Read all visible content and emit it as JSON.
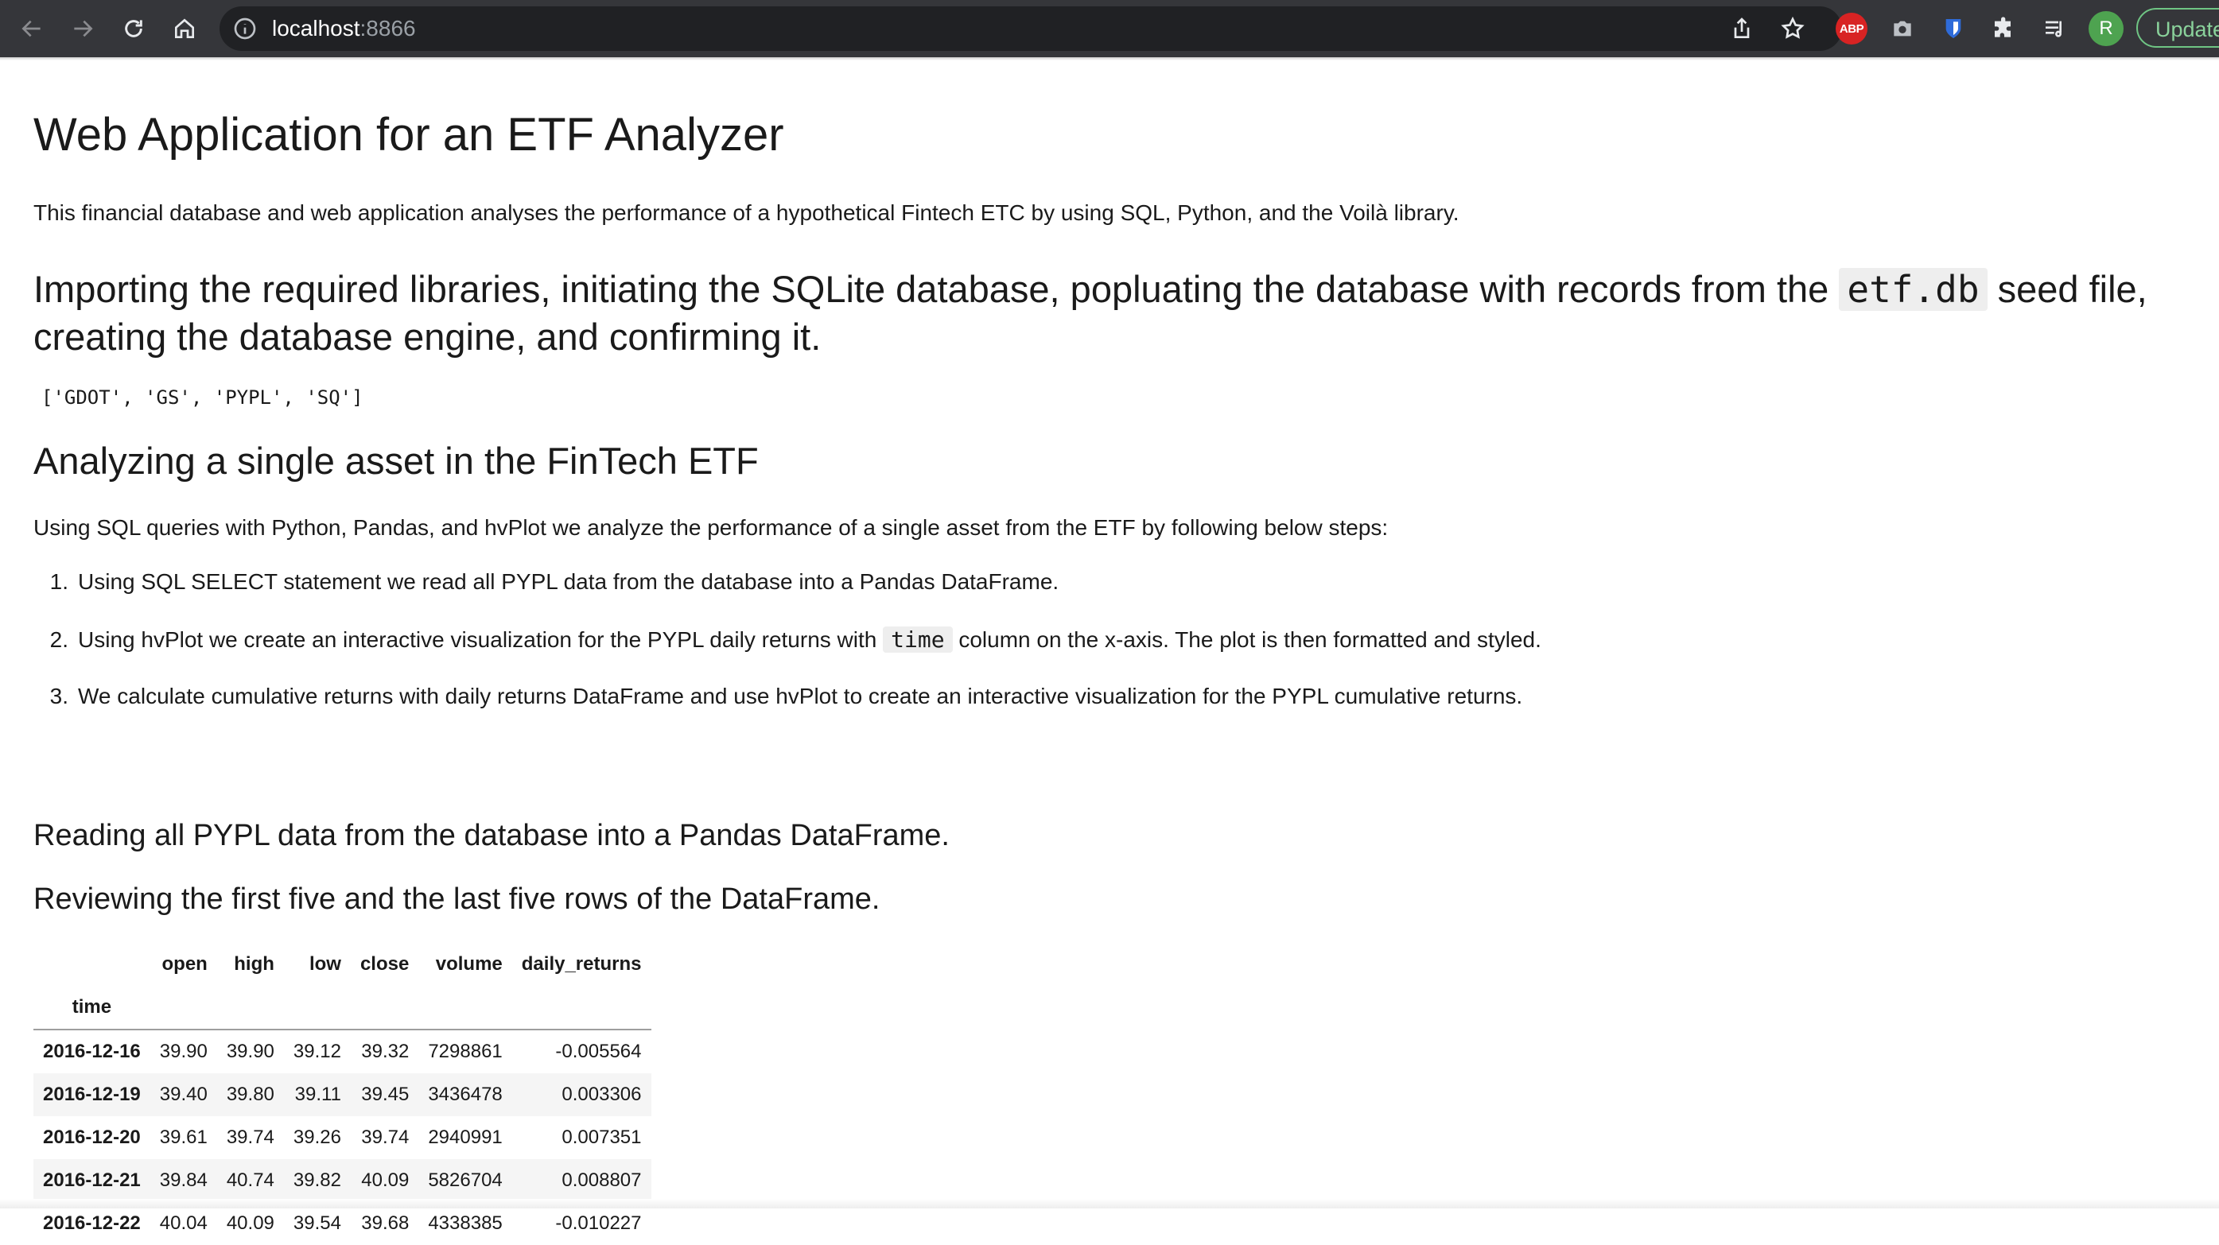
{
  "browser": {
    "url_host": "localhost",
    "url_port": ":8866",
    "profile_initial": "R",
    "update_label": "Update",
    "abp_label": "ABP",
    "avatar_color": "#4ea350",
    "icons": [
      "back-icon",
      "forward-icon",
      "reload-icon",
      "home-icon",
      "info-icon",
      "share-icon",
      "star-icon",
      "camera-icon",
      "bitwarden-icon",
      "puzzle-icon",
      "reading-list-icon"
    ]
  },
  "page": {
    "title": "Web Application for an ETF Analyzer",
    "intro": "This financial database and web application analyses the performance of a hypothetical Fintech ETC by using SQL, Python, and the Voilà library.",
    "import_heading": {
      "before": "Importing the required libraries, initiating the SQLite database, popluating the database with records from the ",
      "code": "etf.db",
      "after_line1": " seed file,",
      "line2": "creating the database engine, and confirming it."
    },
    "tables_output": "['GDOT', 'GS', 'PYPL', 'SQ']",
    "single_asset_heading": "Analyzing a single asset in the FinTech ETF",
    "steps_intro": "Using SQL queries with Python, Pandas, and hvPlot we analyze the performance of a single asset from the ETF by following below steps:",
    "steps": [
      {
        "num": "1.",
        "text": "Using SQL SELECT statement we read all PYPL data from the database into a Pandas DataFrame."
      },
      {
        "num": "2.",
        "before": "Using hvPlot we create an interactive visualization for the PYPL daily returns with ",
        "code": "time",
        "after": " column on the x-axis. The plot is then formatted and styled."
      },
      {
        "num": "3.",
        "text": "We calculate cumulative returns with daily returns DataFrame and use hvPlot to create an interactive visualization for the PYPL cumulative returns."
      }
    ],
    "read_heading": "Reading all PYPL data from the database into a Pandas DataFrame.",
    "review_heading": "Reviewing the first five and the last five rows of the DataFrame."
  },
  "dataframe": {
    "columns": [
      "open",
      "high",
      "low",
      "close",
      "volume",
      "daily_returns"
    ],
    "index_name": "time",
    "rows": [
      {
        "time": "2016-12-16",
        "open": "39.90",
        "high": "39.90",
        "low": "39.12",
        "close": "39.32",
        "volume": "7298861",
        "daily_returns": "-0.005564"
      },
      {
        "time": "2016-12-19",
        "open": "39.40",
        "high": "39.80",
        "low": "39.11",
        "close": "39.45",
        "volume": "3436478",
        "daily_returns": "0.003306"
      },
      {
        "time": "2016-12-20",
        "open": "39.61",
        "high": "39.74",
        "low": "39.26",
        "close": "39.74",
        "volume": "2940991",
        "daily_returns": "0.007351"
      },
      {
        "time": "2016-12-21",
        "open": "39.84",
        "high": "40.74",
        "low": "39.82",
        "close": "40.09",
        "volume": "5826704",
        "daily_returns": "0.008807"
      },
      {
        "time": "2016-12-22",
        "open": "40.04",
        "high": "40.09",
        "low": "39.54",
        "close": "39.68",
        "volume": "4338385",
        "daily_returns": "-0.010227"
      }
    ]
  }
}
